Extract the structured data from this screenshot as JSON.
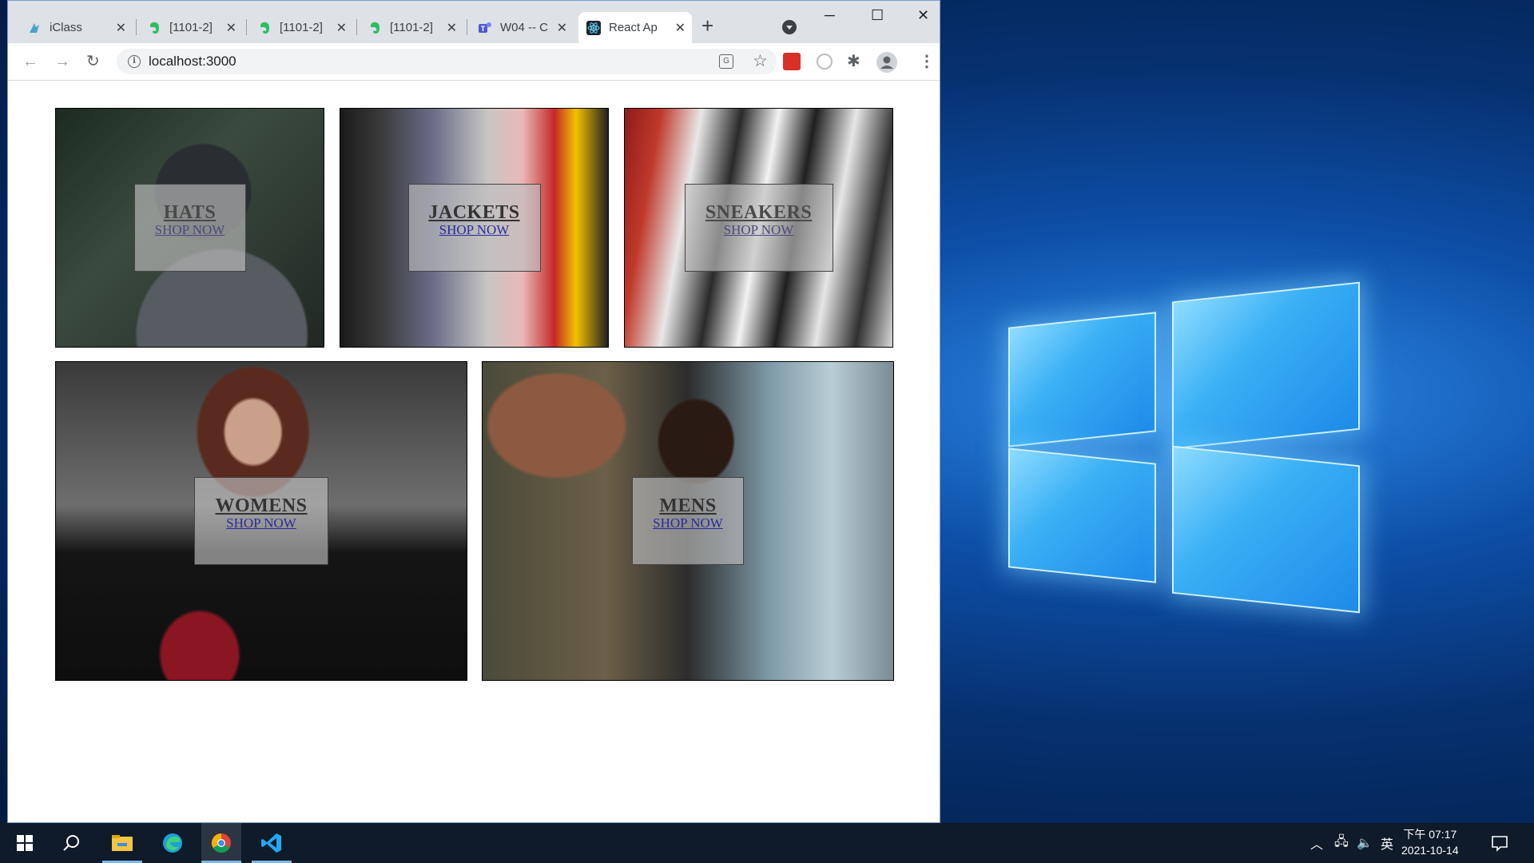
{
  "browser": {
    "tabs": [
      {
        "label": "iClass",
        "favicon": "iclass-icon"
      },
      {
        "label": "[1101-2]",
        "favicon": "evernote-icon"
      },
      {
        "label": "[1101-2]",
        "favicon": "evernote-icon"
      },
      {
        "label": "[1101-2]",
        "favicon": "evernote-icon"
      },
      {
        "label": "W04 -- C",
        "favicon": "teams-icon"
      },
      {
        "label": "React Ap",
        "favicon": "react-icon"
      }
    ],
    "new_tab": "+",
    "url": "localhost:3000",
    "window_controls": {
      "minimize": "─",
      "maximize": "☐",
      "close": "✕"
    }
  },
  "directory": {
    "sections": [
      {
        "title": "HATS",
        "subtitle": "SHOP NOW"
      },
      {
        "title": "JACKETS",
        "subtitle": "SHOP NOW"
      },
      {
        "title": "SNEAKERS",
        "subtitle": "SHOP NOW"
      },
      {
        "title": "WOMENS",
        "subtitle": "SHOP NOW"
      },
      {
        "title": "MENS",
        "subtitle": "SHOP NOW"
      }
    ]
  },
  "taskbar": {
    "apps": [
      "start-icon",
      "search-icon",
      "file-explorer-icon",
      "edge-icon",
      "chrome-icon",
      "vscode-icon"
    ],
    "tray": {
      "ime": "英"
    },
    "clock": {
      "time": "下午 07:17",
      "date": "2021-10-14"
    }
  },
  "colors": {
    "accent": "#1a73e8",
    "taskbar": "#0f1a2a",
    "overlay": "#bebebe"
  }
}
